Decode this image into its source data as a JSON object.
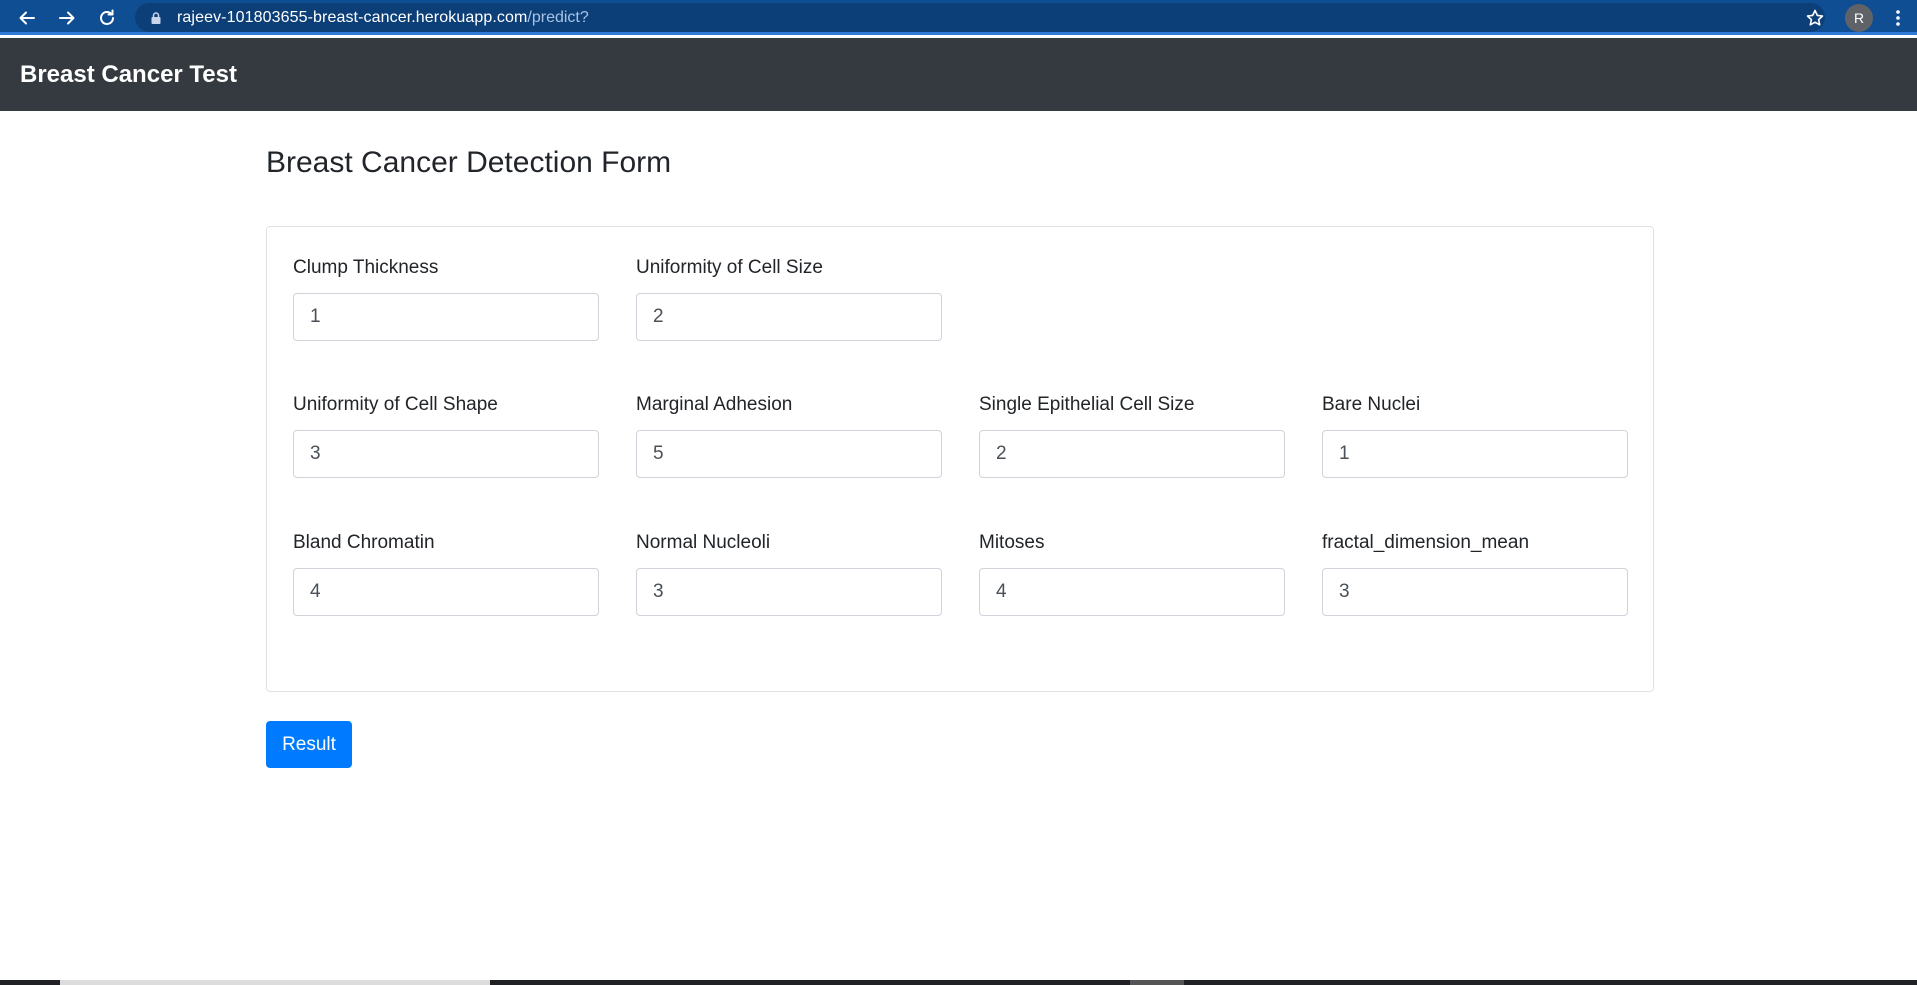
{
  "browser": {
    "url_host": "rajeev-101803655-breast-cancer.herokuapp.com",
    "url_path": "/predict?",
    "profile_initial": "R"
  },
  "navbar": {
    "brand": "Breast Cancer Test"
  },
  "main": {
    "title": "Breast Cancer Detection Form",
    "fields": [
      {
        "label": "Clump Thickness",
        "value": "1"
      },
      {
        "label": "Uniformity of Cell Size",
        "value": "2"
      },
      {
        "label": "Uniformity of Cell Shape",
        "value": "3"
      },
      {
        "label": "Marginal Adhesion",
        "value": "5"
      },
      {
        "label": "Single Epithelial Cell Size",
        "value": "2"
      },
      {
        "label": "Bare Nuclei",
        "value": "1"
      },
      {
        "label": "Bland Chromatin",
        "value": "4"
      },
      {
        "label": "Normal Nucleoli",
        "value": "3"
      },
      {
        "label": "Mitoses",
        "value": "4"
      },
      {
        "label": "fractal_dimension_mean",
        "value": "3"
      }
    ],
    "submit_label": "Result"
  },
  "colors": {
    "browser_bar": "#0f4e92",
    "navbar": "#343a40",
    "primary_button": "#007bff"
  }
}
